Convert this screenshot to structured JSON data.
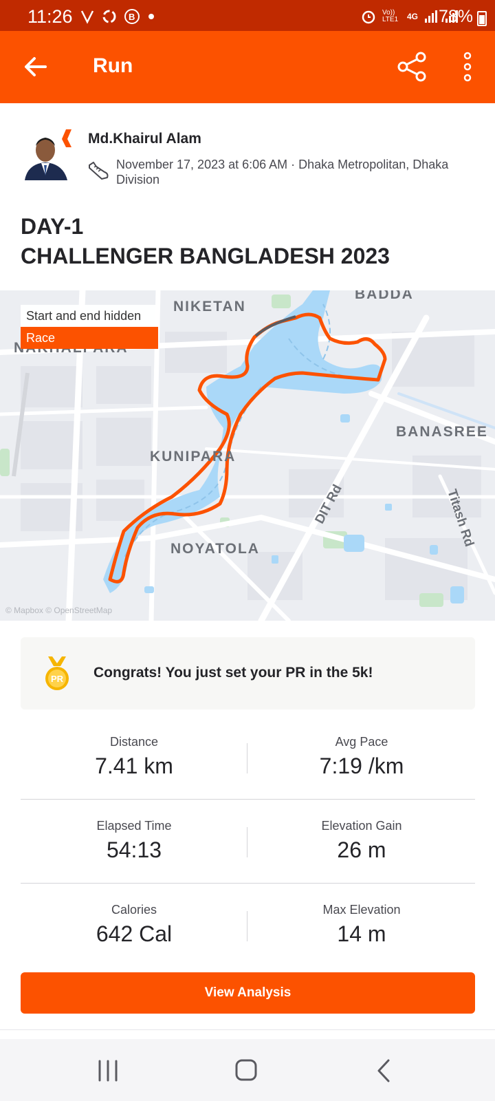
{
  "status_bar": {
    "time": "11:26",
    "battery": "78%",
    "network": "4G",
    "carrier_tag": "Vo)) LTE1",
    "left_icons": [
      "signal-slash-icon",
      "sync-icon",
      "b-badge-icon",
      "dot-icon"
    ],
    "right_icons": [
      "alarm-icon",
      "volte-icon",
      "4g-icon",
      "signal-icon",
      "signal-icon",
      "battery-icon"
    ]
  },
  "app_bar": {
    "title": "Run",
    "back_icon": "arrow-left-icon",
    "share_icon": "share-icon",
    "more_icon": "more-vertical-icon"
  },
  "athlete": {
    "name": "Md.Khairul Alam",
    "meta": "November 17, 2023 at 6:06 AM · Dhaka Metropolitan, Dhaka Division"
  },
  "activity": {
    "title_line1": "DAY-1",
    "title_line2": "CHALLENGER BANGLADESH 2023"
  },
  "map": {
    "badge_hidden": "Start and end hidden",
    "badge_race": "Race",
    "labels": {
      "badda": "BADDA",
      "niketan": "NIKETAN",
      "nakhalpara": "NAKHALPARA",
      "banasree": "BANASREE",
      "kunipara": "KUNIPARA",
      "noyatola": "NOYATOLA",
      "dit_rd": "DIT Rd",
      "titash_rd": "Titash Rd"
    },
    "credit": "© Mapbox © OpenStreetMap",
    "route_color": "#fc5200",
    "water_color": "#aad8f8"
  },
  "pr_card": {
    "text": "Congrats! You just set your PR in the 5k!",
    "icon_label": "PR"
  },
  "stats": [
    {
      "left_label": "Distance",
      "left_value": "7.41 km",
      "right_label": "Avg Pace",
      "right_value": "7:19 /km"
    },
    {
      "left_label": "Elapsed Time",
      "left_value": "54:13",
      "right_label": "Elevation Gain",
      "right_value": "26 m"
    },
    {
      "left_label": "Calories",
      "left_value": "642 Cal",
      "right_label": "Max Elevation",
      "right_value": "14 m"
    }
  ],
  "button": {
    "view_analysis": "View Analysis"
  },
  "colors": {
    "accent": "#fc5200",
    "status_bar": "#c02a00"
  }
}
